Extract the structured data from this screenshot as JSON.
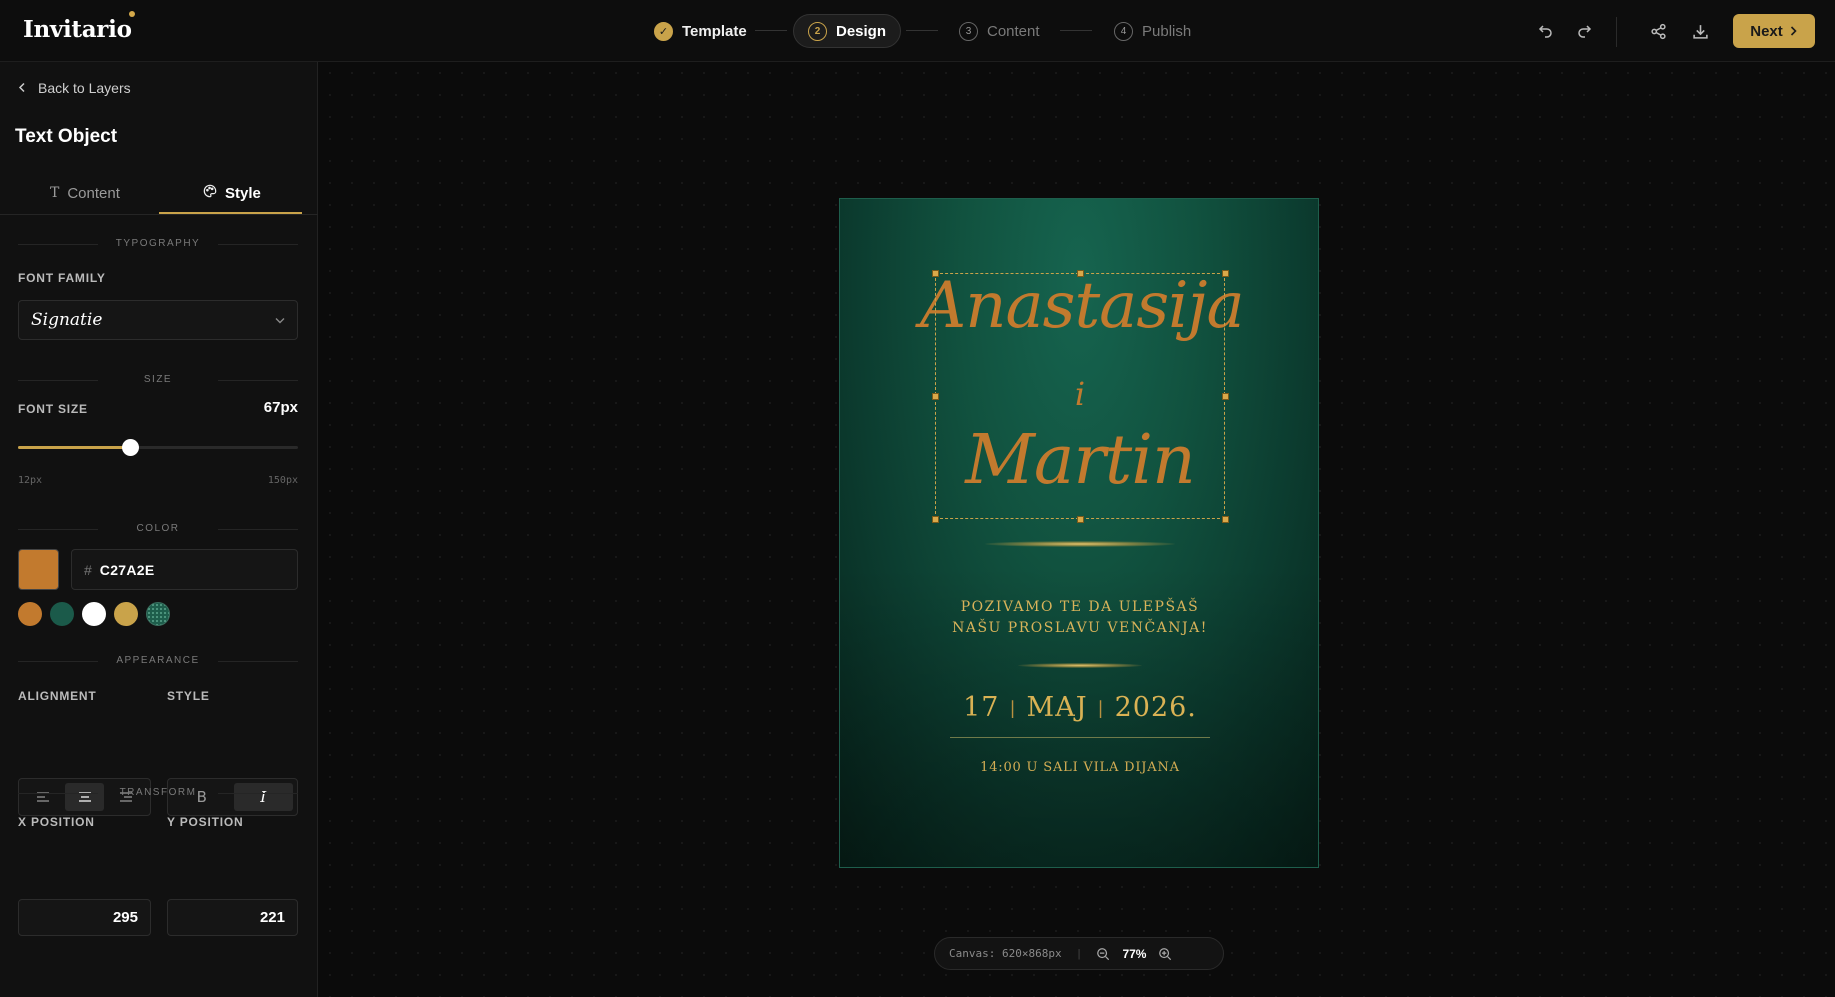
{
  "app": {
    "logo": "Invitario"
  },
  "steps": [
    {
      "num": "✓",
      "label": "Template",
      "state": "done"
    },
    {
      "num": "2",
      "label": "Design",
      "state": "active"
    },
    {
      "num": "3",
      "label": "Content",
      "state": "todo"
    },
    {
      "num": "4",
      "label": "Publish",
      "state": "todo"
    }
  ],
  "toolbar": {
    "next_label": "Next"
  },
  "panel": {
    "back_label": "Back to Layers",
    "title": "Text Object",
    "tabs": {
      "content": "Content",
      "style": "Style"
    },
    "typography": {
      "section": "TYPOGRAPHY",
      "font_family_label": "FONT FAMILY",
      "font_family_value": "Signatie"
    },
    "size": {
      "section": "SIZE",
      "font_size_label": "FONT SIZE",
      "font_size_value": "67px",
      "min": "12px",
      "max": "150px",
      "level_fraction": 0.4
    },
    "color": {
      "section": "COLOR",
      "hash": "#",
      "hex_value": "C27A2E",
      "current": "#c27a2e",
      "presets": [
        "#c27a2e",
        "#1b5a4a",
        "#ffffff",
        "#c9a34a",
        "#1e5e4c"
      ]
    },
    "appearance": {
      "section": "APPEARANCE",
      "alignment_label": "ALIGNMENT",
      "style_label": "STYLE",
      "alignment_selected": "center",
      "style_selected": "italic",
      "bold_glyph": "B",
      "italic_glyph": "I"
    },
    "transform": {
      "section": "TRANSFORM",
      "x_label": "X POSITION",
      "y_label": "Y POSITION",
      "x_value": "295",
      "y_value": "221"
    }
  },
  "invitation": {
    "name1": "Anastasija",
    "and": "i",
    "name2": "Martin",
    "invite_line1": "POZIVAMO TE DA ULEPŠAŠ",
    "invite_line2": "NAŠU PROSLAVU VENČANJA!",
    "day": "17",
    "month": "MAJ",
    "year": "2026.",
    "separator": "|",
    "venue": "14:00 U SALI VILA DIJANA"
  },
  "statusbar": {
    "canvas": "Canvas: 620×868px",
    "zoom": "77%",
    "separator": "|"
  },
  "colors": {
    "accent": "#c9a34a",
    "card_green": "#11523f",
    "text_gold": "#d8b35a"
  }
}
